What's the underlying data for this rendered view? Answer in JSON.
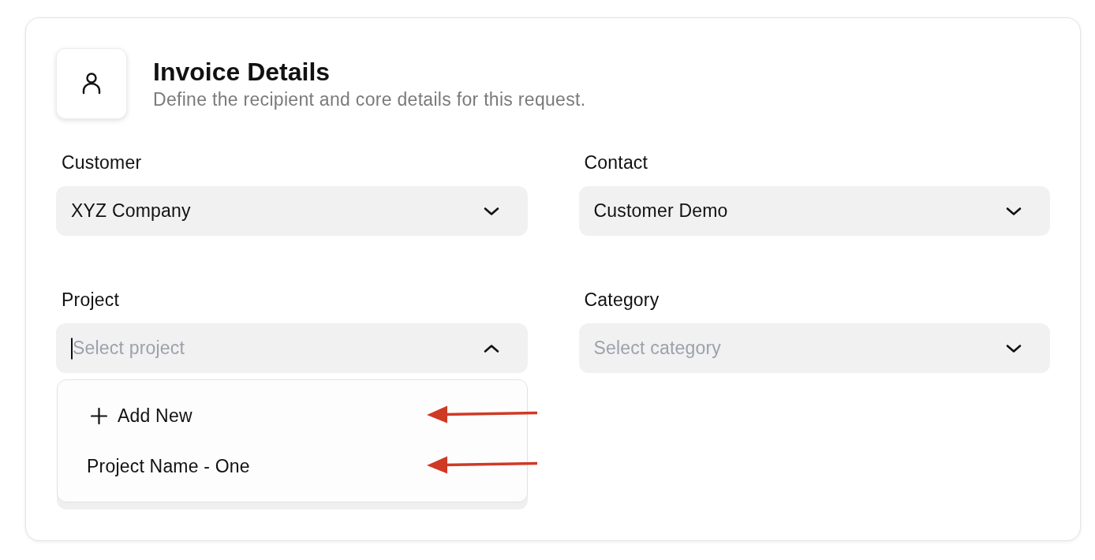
{
  "header": {
    "title": "Invoice Details",
    "subtitle": "Define the recipient and core details for this request."
  },
  "fields": [
    {
      "label": "Customer",
      "value": "XYZ Company",
      "expanded": false
    },
    {
      "label": "Contact",
      "value": "Customer Demo",
      "expanded": false
    },
    {
      "label": "Project",
      "placeholder": "Select project",
      "expanded": true,
      "focused": true,
      "options": [
        {
          "kind": "add",
          "label": "Add New",
          "annotated": true
        },
        {
          "kind": "item",
          "label": "Project Name - One",
          "annotated": true
        }
      ]
    },
    {
      "label": "Category",
      "placeholder": "Select category",
      "expanded": false
    }
  ]
}
